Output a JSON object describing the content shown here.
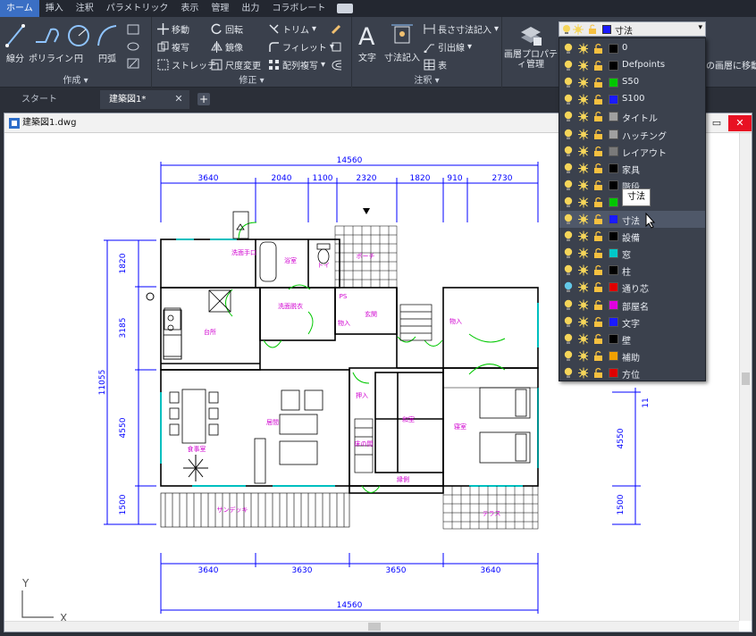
{
  "menu": {
    "tabs": [
      "ホーム",
      "挿入",
      "注釈",
      "パラメトリック",
      "表示",
      "管理",
      "出力",
      "コラボレート"
    ]
  },
  "ribbon": {
    "draw": {
      "title": "作成",
      "line": "線分",
      "polyline": "ポリライン",
      "circle": "円",
      "arc": "円弧"
    },
    "modify": {
      "title": "修正",
      "move": "移動",
      "rotate": "回転",
      "trim": "トリム",
      "copy": "複写",
      "mirror": "鏡像",
      "fillet": "フィレット",
      "stretch": "ストレッチ",
      "scale": "尺度変更",
      "array": "配列複写"
    },
    "annotation": {
      "title": "注釈",
      "text": "文字",
      "dimension": "寸法記入",
      "linear_dim": "長さ寸法記入",
      "leader": "引出線",
      "table": "表"
    },
    "layers": {
      "properties": "画層プロパティ管理",
      "move_to_layer": "の画層に移動"
    }
  },
  "file_tabs": {
    "start": "スタート",
    "drawing": "建築図1*"
  },
  "document": {
    "title": "建築図1.dwg"
  },
  "layer_combo": {
    "current": "寸法",
    "current_color": "#1a1aff"
  },
  "layers": [
    {
      "name": "0",
      "color": "#000000",
      "bulb": "#f5d55a"
    },
    {
      "name": "Defpoints",
      "color": "#000000",
      "bulb": "#f5d55a"
    },
    {
      "name": "S50",
      "color": "#00c800",
      "bulb": "#f5d55a"
    },
    {
      "name": "S100",
      "color": "#1a1aff",
      "bulb": "#f5d55a"
    },
    {
      "name": "タイトル",
      "color": "#a0a0a0",
      "bulb": "#f5d55a"
    },
    {
      "name": "ハッチング",
      "color": "#a0a0a0",
      "bulb": "#f5d55a"
    },
    {
      "name": "レイアウト",
      "color": "#7a7a7a",
      "bulb": "#f5d55a"
    },
    {
      "name": "家具",
      "color": "#000000",
      "bulb": "#f5d55a"
    },
    {
      "name": "階段",
      "color": "#000000",
      "bulb": "#f5d55a"
    },
    {
      "name": "",
      "color": "#00c800",
      "bulb": "#f5d55a"
    },
    {
      "name": "寸法",
      "color": "#1a1aff",
      "bulb": "#f5d55a"
    },
    {
      "name": "設備",
      "color": "#000000",
      "bulb": "#f5d55a"
    },
    {
      "name": "窓",
      "color": "#00c8c8",
      "bulb": "#f5d55a"
    },
    {
      "name": "柱",
      "color": "#000000",
      "bulb": "#f5d55a"
    },
    {
      "name": "通り芯",
      "color": "#e00000",
      "bulb": "#63c8e8"
    },
    {
      "name": "部屋名",
      "color": "#e000e0",
      "bulb": "#f5d55a"
    },
    {
      "name": "文字",
      "color": "#1a1aff",
      "bulb": "#f5d55a"
    },
    {
      "name": "壁",
      "color": "#000000",
      "bulb": "#f5d55a"
    },
    {
      "name": "補助",
      "color": "#f0a000",
      "bulb": "#f5d55a"
    },
    {
      "name": "方位",
      "color": "#e00000",
      "bulb": "#f5d55a"
    }
  ],
  "tooltip": "寸法",
  "dimensions": {
    "top_total": "14560",
    "top": [
      "3640",
      "2040",
      "1100",
      "2320",
      "1820",
      "910",
      "2730"
    ],
    "bottom": [
      "3640",
      "3630",
      "3650",
      "3640"
    ],
    "bottom_total": "14560",
    "left_total": "11055",
    "left": [
      "1820",
      "3185",
      "4550",
      "1500"
    ],
    "right": [
      "4550",
      "1500"
    ],
    "right_total_partial": "11"
  },
  "rooms": {
    "wash": "洗面手口",
    "bath": "浴室",
    "toilet": "トイ",
    "porch": "ポーチ",
    "kitchen": "台所",
    "wash2": "洗面脱衣",
    "storage": "物入",
    "ps": "PS",
    "entrance": "玄関",
    "dining": "食事室",
    "living": "居間",
    "closet": "押入",
    "tokonoma": "床の間",
    "japanese": "和室",
    "bedroom": "寝室",
    "corridor": "縁側",
    "sundeck": "サンデッキ",
    "terrace": "テラス",
    "storage2": "物入"
  },
  "ucs": {
    "x": "X",
    "y": "Y"
  }
}
